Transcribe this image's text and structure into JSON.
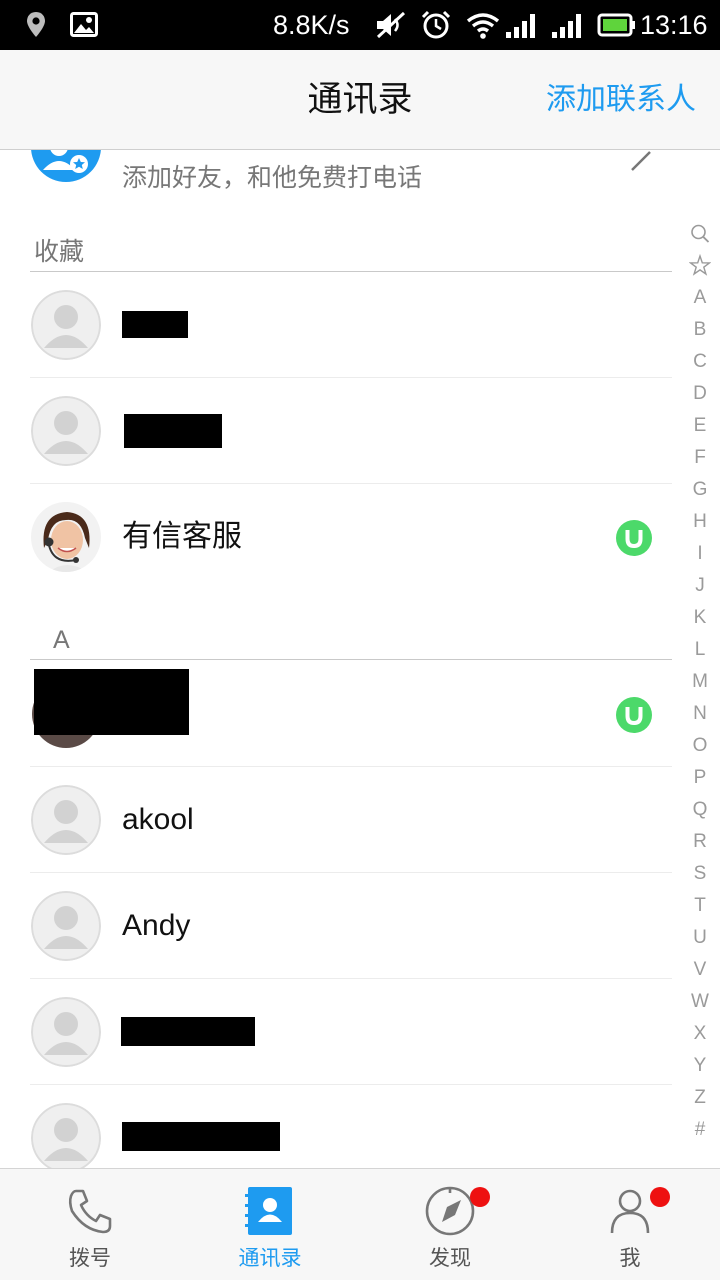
{
  "status_bar": {
    "net_speed": "8.8K/s",
    "time": "13:16",
    "icons": [
      "location-icon",
      "image-notification-icon",
      "mute-icon",
      "alarm-icon",
      "wifi-icon",
      "signal-icon",
      "signal-icon",
      "battery-icon"
    ]
  },
  "header": {
    "title": "通讯录",
    "add_contact": "添加联系人"
  },
  "add_friend": {
    "text": "添加好友，和他免费打电话",
    "icon": "add-friend-icon"
  },
  "sections": {
    "favorites": {
      "title": "收藏",
      "contacts": [
        {
          "name": "",
          "redacted": true,
          "avatar": "default-avatar-icon",
          "badge": false
        },
        {
          "name": "",
          "redacted": true,
          "avatar": "default-avatar-icon",
          "badge": false
        },
        {
          "name": "有信客服",
          "redacted": false,
          "avatar": "support-agent-photo",
          "badge": true
        }
      ]
    },
    "a": {
      "title": "A",
      "contacts": [
        {
          "name": "",
          "redacted": true,
          "avatar": "photo-avatar",
          "badge": true
        },
        {
          "name": "akool",
          "redacted": false,
          "avatar": "default-avatar-icon",
          "badge": false
        },
        {
          "name": "Andy",
          "redacted": false,
          "avatar": "default-avatar-icon",
          "badge": false
        },
        {
          "name": "",
          "redacted": true,
          "avatar": "default-avatar-icon",
          "badge": false
        },
        {
          "name": "",
          "redacted": true,
          "avatar": "default-avatar-icon",
          "badge": false
        }
      ]
    }
  },
  "index_bar": {
    "icons": [
      "search-icon",
      "star-icon"
    ],
    "letters": [
      "A",
      "B",
      "C",
      "D",
      "E",
      "F",
      "G",
      "H",
      "I",
      "J",
      "K",
      "L",
      "M",
      "N",
      "O",
      "P",
      "Q",
      "R",
      "S",
      "T",
      "U",
      "V",
      "W",
      "X",
      "Y",
      "Z",
      "#"
    ]
  },
  "bottom_nav": {
    "dial": "拨号",
    "contacts": "通讯录",
    "discover": "发现",
    "me": "我",
    "active": "contacts",
    "discover_has_dot": true,
    "me_has_dot": true
  },
  "colors": {
    "accent": "#1e9bf0",
    "badge_green": "#4cd96a",
    "notification_red": "#ee1111"
  }
}
